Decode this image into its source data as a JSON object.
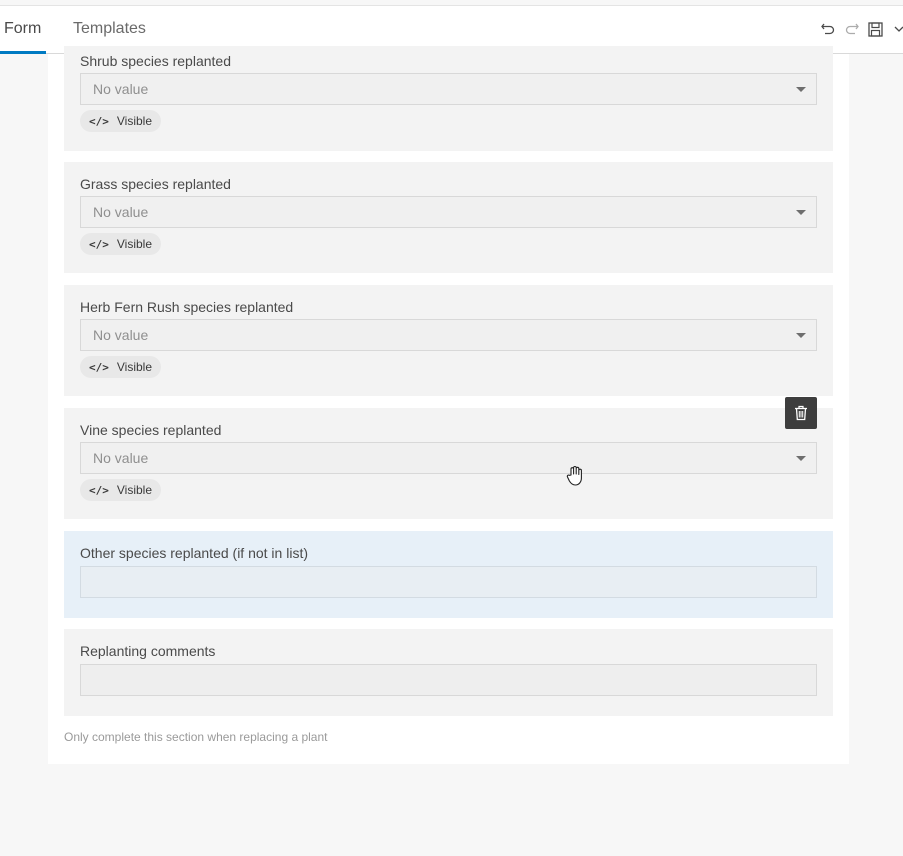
{
  "tabs": [
    {
      "label": "Form"
    },
    {
      "label": "Templates"
    }
  ],
  "toolbar": {
    "undo_icon": "undo-icon",
    "redo_icon": "redo-icon",
    "save_icon": "save-icon",
    "more_icon": "chevron-down-icon"
  },
  "fields": [
    {
      "label": "Shrub species replanted",
      "type": "select",
      "value": "No value",
      "visibility_chip": "Visible"
    },
    {
      "label": "Grass species replanted",
      "type": "select",
      "value": "No value",
      "visibility_chip": "Visible"
    },
    {
      "label": "Herb Fern Rush species replanted",
      "type": "select",
      "value": "No value",
      "visibility_chip": "Visible"
    },
    {
      "label": "Vine species replanted",
      "type": "select",
      "value": "No value",
      "visibility_chip": "Visible"
    },
    {
      "label": "Other species replanted (if not in list)",
      "type": "text",
      "value": "",
      "state": "selected"
    },
    {
      "label": "Replanting comments",
      "type": "text",
      "value": ""
    }
  ],
  "group_hint": "Only complete this section when replacing a plant",
  "colors": {
    "accent": "#007ac2",
    "selected_card": "#e7f0f8",
    "card": "#f3f3f3"
  }
}
